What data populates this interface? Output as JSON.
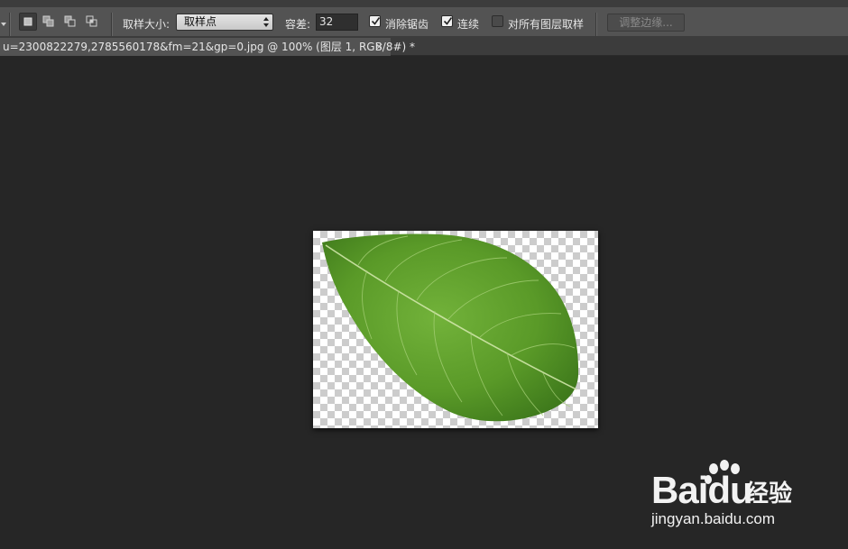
{
  "options_bar": {
    "sample_size_label": "取样大小:",
    "sample_size_value": "取样点",
    "tolerance_label": "容差:",
    "tolerance_value": "32",
    "anti_alias_label": "消除锯齿",
    "anti_alias_checked": true,
    "contiguous_label": "连续",
    "contiguous_checked": true,
    "sample_all_layers_label": "对所有图层取样",
    "sample_all_layers_checked": false,
    "refine_edge_label": "调整边缘..."
  },
  "document_tab": {
    "title": "u=2300822279,2785560178&fm=21&gp=0.jpg @ 100% (图层 1, RGB/8#) *",
    "close": "×"
  },
  "canvas": {
    "content": "green leaf on transparent background",
    "leaf_color": "#5c9a2a"
  },
  "watermark": {
    "brand": "Bai",
    "brand_tail": "du",
    "product": "经验",
    "url": "jingyan.baidu.com"
  }
}
